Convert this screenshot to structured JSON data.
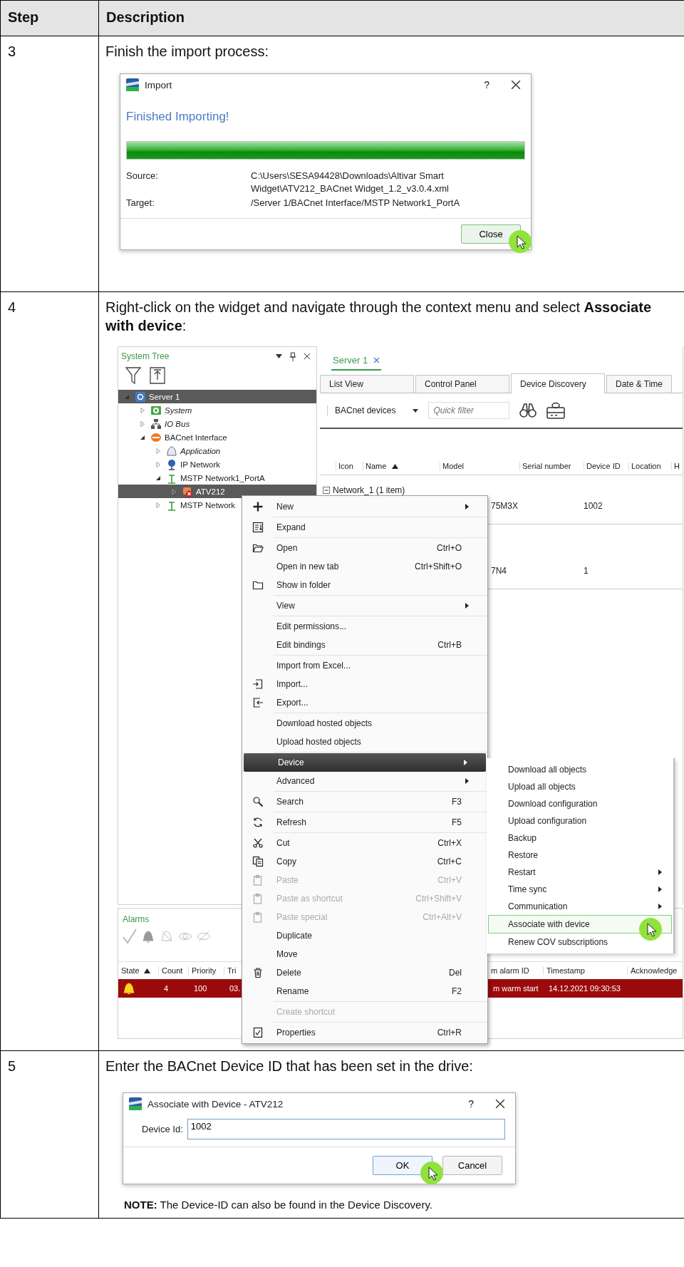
{
  "table": {
    "columns": [
      "Step",
      "Description"
    ],
    "rows": [
      {
        "step": "3",
        "text": "Finish the import process:",
        "figure": {
          "kind": "import_dialog",
          "title": "Import",
          "help": "?",
          "heading": "Finished Importing!",
          "progress": {
            "level": 1
          },
          "fields": [
            {
              "label": "Source:",
              "value": "C:\\Users\\SESA94428\\Downloads\\Altivar Smart Widget\\ATV212_BACnet Widget_1.2_v3.0.4.xml"
            },
            {
              "label": "Target:",
              "value": "/Server 1/BACnet Interface/MSTP Network1_PortA"
            }
          ],
          "buttons": [
            {
              "label": "Close",
              "cursor": true
            }
          ]
        }
      },
      {
        "step": "4",
        "text": "Right-click on the widget and navigate through the context menu and select **Associate with device**:",
        "figure": {
          "kind": "workspace",
          "system_tree": {
            "title": "System Tree",
            "nodes": [
              {
                "label": "Server 1",
                "kind": "server",
                "expanded": true,
                "selected": true,
                "italic": false,
                "children": [
                  {
                    "label": "System",
                    "kind": "system",
                    "expanded": false,
                    "selected": false,
                    "italic": true
                  },
                  {
                    "label": "IO Bus",
                    "kind": "bus",
                    "expanded": false,
                    "selected": false,
                    "italic": true
                  },
                  {
                    "label": "BACnet Interface",
                    "kind": "interface",
                    "expanded": true,
                    "selected": false,
                    "italic": false,
                    "children": [
                      {
                        "label": "Application",
                        "kind": "application",
                        "expanded": false,
                        "selected": false,
                        "italic": true
                      },
                      {
                        "label": "IP Network",
                        "kind": "network",
                        "expanded": false,
                        "selected": false,
                        "italic": false
                      },
                      {
                        "label": "MSTP Network1_PortA",
                        "kind": "mstp",
                        "expanded": true,
                        "selected": false,
                        "italic": false,
                        "children": [
                          {
                            "label": "ATV212",
                            "kind": "device",
                            "expanded": false,
                            "selected": true,
                            "italic": false
                          }
                        ]
                      },
                      {
                        "label": "MSTP Network",
                        "kind": "mstp",
                        "expanded": false,
                        "selected": false,
                        "italic": false
                      }
                    ]
                  }
                ]
              }
            ]
          },
          "document": {
            "tab": "Server 1",
            "views": [
              {
                "label": "List View",
                "selected": false
              },
              {
                "label": "Control Panel",
                "selected": false
              },
              {
                "label": "Device Discovery",
                "selected": true
              },
              {
                "label": "Date & Time",
                "selected": false
              }
            ],
            "source": "BACnet devices",
            "filter_placeholder": "Quick filter",
            "columns": [
              {
                "label": "Icon",
                "sorted": false
              },
              {
                "label": "Name",
                "sorted": true
              },
              {
                "label": "Model",
                "sorted": false
              },
              {
                "label": "Serial number",
                "sorted": false
              },
              {
                "label": "Device ID",
                "sorted": false
              },
              {
                "label": "Location",
                "sorted": false
              },
              {
                "label": "H",
                "sorted": false
              }
            ],
            "groups": [
              {
                "label": "Network_1 (1 item)",
                "expanded": true,
                "rows": [
                  {
                    "model": "75M3X",
                    "device_id": "1002"
                  }
                ]
              },
              {
                "rows": [
                  {
                    "model": "7N4",
                    "device_id": "1"
                  }
                ]
              }
            ]
          },
          "alarms": {
            "title": "Alarms",
            "columns": [
              {
                "label": "State",
                "sorted": true
              },
              {
                "label": "Count",
                "sorted": false
              },
              {
                "label": "Priority",
                "sorted": false
              },
              {
                "label": "Tri",
                "sorted": false
              },
              {
                "label": "m alarm ID",
                "sorted": false
              },
              {
                "label": "Timestamp",
                "sorted": false
              },
              {
                "label": "Acknowledge",
                "sorted": false
              }
            ],
            "rows": [
              {
                "color": "#9c0b0b",
                "cells": [
                  "",
                  "4",
                  "100",
                  "03.",
                  "m warm start",
                  "14.12.2021 09:30:53"
                ]
              }
            ]
          },
          "context_menu": {
            "groups": [
              {
                "items": [
                  {
                    "label": "New",
                    "kind": "plus",
                    "has_submenu": true,
                    "disabled": false,
                    "selected": false
                  }
                ]
              },
              {
                "items": [
                  {
                    "label": "Expand",
                    "kind": "expand",
                    "has_submenu": false,
                    "disabled": false,
                    "selected": false
                  }
                ]
              },
              {
                "items": [
                  {
                    "label": "Open",
                    "shortcut": "Ctrl+O",
                    "kind": "open",
                    "has_submenu": false,
                    "disabled": false,
                    "selected": false
                  },
                  {
                    "label": "Open in new tab",
                    "shortcut": "Ctrl+Shift+O",
                    "kind": "plain",
                    "has_submenu": false,
                    "disabled": false,
                    "selected": false
                  },
                  {
                    "label": "Show in folder",
                    "kind": "folder",
                    "has_submenu": false,
                    "disabled": false,
                    "selected": false
                  }
                ]
              },
              {
                "items": [
                  {
                    "label": "View",
                    "kind": "plain",
                    "has_submenu": true,
                    "disabled": false,
                    "selected": false
                  }
                ]
              },
              {
                "items": [
                  {
                    "label": "Edit permissions...",
                    "kind": "plain",
                    "has_submenu": false,
                    "disabled": false,
                    "selected": false
                  },
                  {
                    "label": "Edit bindings",
                    "shortcut": "Ctrl+B",
                    "kind": "plain",
                    "has_submenu": false,
                    "disabled": false,
                    "selected": false
                  }
                ]
              },
              {
                "items": [
                  {
                    "label": "Import from Excel...",
                    "kind": "plain",
                    "has_submenu": false,
                    "disabled": false,
                    "selected": false
                  },
                  {
                    "label": "Import...",
                    "kind": "import",
                    "has_submenu": false,
                    "disabled": false,
                    "selected": false
                  },
                  {
                    "label": "Export...",
                    "kind": "export",
                    "has_submenu": false,
                    "disabled": false,
                    "selected": false
                  }
                ]
              },
              {
                "items": [
                  {
                    "label": "Download hosted objects",
                    "kind": "plain",
                    "has_submenu": false,
                    "disabled": false,
                    "selected": false
                  },
                  {
                    "label": "Upload hosted objects",
                    "kind": "plain",
                    "has_submenu": false,
                    "disabled": false,
                    "selected": false
                  }
                ]
              },
              {
                "items": [
                  {
                    "label": "Device",
                    "kind": "plain",
                    "has_submenu": true,
                    "disabled": false,
                    "selected": true
                  },
                  {
                    "label": "Advanced",
                    "kind": "plain",
                    "has_submenu": true,
                    "disabled": false,
                    "selected": false
                  }
                ]
              },
              {
                "items": [
                  {
                    "label": "Search",
                    "shortcut": "F3",
                    "kind": "search",
                    "has_submenu": false,
                    "disabled": false,
                    "selected": false
                  }
                ]
              },
              {
                "items": [
                  {
                    "label": "Refresh",
                    "shortcut": "F5",
                    "kind": "refresh",
                    "has_submenu": false,
                    "disabled": false,
                    "selected": false
                  }
                ]
              },
              {
                "items": [
                  {
                    "label": "Cut",
                    "shortcut": "Ctrl+X",
                    "kind": "cut",
                    "has_submenu": false,
                    "disabled": false,
                    "selected": false
                  },
                  {
                    "label": "Copy",
                    "shortcut": "Ctrl+C",
                    "kind": "copy",
                    "has_submenu": false,
                    "disabled": false,
                    "selected": false
                  },
                  {
                    "label": "Paste",
                    "shortcut": "Ctrl+V",
                    "kind": "paste",
                    "has_submenu": false,
                    "disabled": true,
                    "selected": false
                  },
                  {
                    "label": "Paste as shortcut",
                    "shortcut": "Ctrl+Shift+V",
                    "kind": "paste",
                    "has_submenu": false,
                    "disabled": true,
                    "selected": false
                  },
                  {
                    "label": "Paste special",
                    "shortcut": "Ctrl+Alt+V",
                    "kind": "paste",
                    "has_submenu": false,
                    "disabled": true,
                    "selected": false
                  },
                  {
                    "label": "Duplicate",
                    "kind": "plain",
                    "has_submenu": false,
                    "disabled": false,
                    "selected": false
                  },
                  {
                    "label": "Move",
                    "kind": "plain",
                    "has_submenu": false,
                    "disabled": false,
                    "selected": false
                  },
                  {
                    "label": "Delete",
                    "shortcut": "Del",
                    "kind": "trash",
                    "has_submenu": false,
                    "disabled": false,
                    "selected": false
                  },
                  {
                    "label": "Rename",
                    "shortcut": "F2",
                    "kind": "plain",
                    "has_submenu": false,
                    "disabled": false,
                    "selected": false
                  }
                ]
              },
              {
                "items": [
                  {
                    "label": "Create shortcut",
                    "kind": "plain",
                    "has_submenu": false,
                    "disabled": true,
                    "selected": false
                  }
                ]
              },
              {
                "items": [
                  {
                    "label": "Properties",
                    "shortcut": "Ctrl+R",
                    "kind": "properties",
                    "has_submenu": false,
                    "disabled": false,
                    "selected": false
                  }
                ]
              }
            ]
          },
          "submenu": {
            "items": [
              {
                "label": "Download all objects",
                "has_submenu": false,
                "selected": false,
                "cursor": false
              },
              {
                "label": "Upload all objects",
                "has_submenu": false,
                "selected": false,
                "cursor": false
              },
              {
                "label": "Download configuration",
                "has_submenu": false,
                "selected": false,
                "cursor": false
              },
              {
                "label": "Upload configuration",
                "has_submenu": false,
                "selected": false,
                "cursor": false
              },
              {
                "label": "Backup",
                "has_submenu": false,
                "selected": false,
                "cursor": false
              },
              {
                "label": "Restore",
                "has_submenu": false,
                "selected": false,
                "cursor": false
              },
              {
                "label": "Restart",
                "has_submenu": true,
                "selected": false,
                "cursor": false
              },
              {
                "label": "Time sync",
                "has_submenu": true,
                "selected": false,
                "cursor": false
              },
              {
                "label": "Communication",
                "has_submenu": true,
                "selected": false,
                "cursor": false
              },
              {
                "label": "Associate with device",
                "has_submenu": false,
                "selected": true,
                "cursor": true
              },
              {
                "label": "Renew COV subscriptions",
                "has_submenu": false,
                "selected": false,
                "cursor": false
              }
            ]
          }
        }
      },
      {
        "step": "5",
        "text": "Enter the BACnet Device ID that has been set in the drive:",
        "figure": {
          "kind": "device_dialog",
          "title": "Associate with Device - ATV212",
          "help": "?",
          "field": {
            "label": "Device Id:",
            "value": "1002"
          },
          "buttons": [
            {
              "label": "OK",
              "cursor": true
            },
            {
              "label": "Cancel",
              "cursor": false
            }
          ]
        },
        "note": "**NOTE:** The Device-ID can also be found in the Device Discovery."
      }
    ]
  }
}
